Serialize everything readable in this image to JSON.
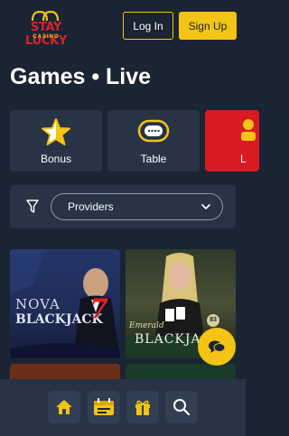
{
  "header": {
    "logo_text": "STAY LUCKY",
    "logo_sub": "CASINO",
    "login_label": "Log In",
    "signup_label": "Sign Up"
  },
  "page": {
    "title": "Games • Live"
  },
  "categories": [
    {
      "label": "Bonus",
      "icon": "star-icon"
    },
    {
      "label": "Table",
      "icon": "chip-icon"
    },
    {
      "label": "L",
      "icon": "live-icon"
    }
  ],
  "filters": {
    "providers_label": "Providers"
  },
  "games": [
    {
      "line1": "NOVA",
      "line2": "BLACKJACK",
      "badge": "7"
    },
    {
      "line1": "Emerald",
      "line2": "BLACKJA",
      "badge": "83"
    }
  ],
  "colors": {
    "accent": "#f3c316",
    "background": "#1b2433",
    "card": "#283346",
    "live": "#d81b22"
  }
}
